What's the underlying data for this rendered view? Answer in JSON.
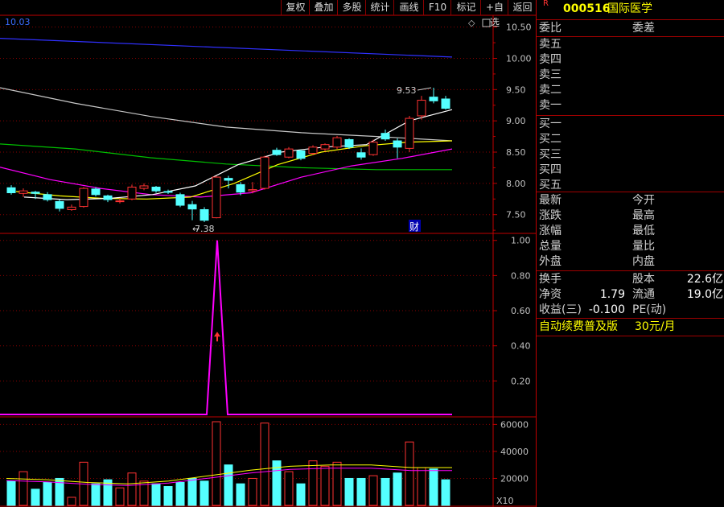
{
  "toolbar": [
    "复权",
    "叠加",
    "多股",
    "统计",
    "画线",
    "F10",
    "标记",
    "+自选",
    "返回"
  ],
  "stock": {
    "flag": "R",
    "code": "000516",
    "name": "国际医学"
  },
  "top_corner_value": "10.03",
  "price_axis": [
    "10.50",
    "10.00",
    "9.50",
    "9.00",
    "8.50",
    "8.00",
    "7.50"
  ],
  "annotations": {
    "high": "9.53",
    "low": "7.38",
    "fin_marker": "财"
  },
  "indicator_axis": [
    "1.00",
    "0.80",
    "0.60",
    "0.40",
    "0.20"
  ],
  "volume_axis": [
    "60000",
    "40000",
    "20000"
  ],
  "volume_unit": "X10",
  "panel": {
    "header": {
      "left": "委比",
      "right": "委差"
    },
    "sell": [
      "卖五",
      "卖四",
      "卖三",
      "卖二",
      "卖一"
    ],
    "buy": [
      "买一",
      "买二",
      "买三",
      "买四",
      "买五"
    ],
    "stats": [
      [
        "最新",
        "",
        "今开",
        ""
      ],
      [
        "涨跌",
        "",
        "最高",
        ""
      ],
      [
        "涨幅",
        "",
        "最低",
        ""
      ],
      [
        "总量",
        "",
        "量比",
        ""
      ],
      [
        "外盘",
        "",
        "内盘",
        ""
      ]
    ],
    "fund": [
      [
        "换手",
        "",
        "股本",
        "22.6亿"
      ],
      [
        "净资",
        "1.79",
        "流通",
        "19.0亿"
      ],
      [
        "收益(三)",
        "-0.100",
        "PE(动)",
        ""
      ]
    ],
    "banner": {
      "label": "自动续费普及版",
      "price": "30元/月"
    }
  },
  "colors": {
    "up": "#ff3232",
    "down": "#54ffff",
    "grid": "#8a0000",
    "border": "#c00000",
    "ma5": "#ffffff",
    "ma10": "#ffff00",
    "ma20": "#ff00ff",
    "ma60": "#00c000",
    "ma120": "#c8c8c8",
    "ma250": "#3030ff",
    "indicator": "#ff00ff"
  },
  "chart_data": {
    "type": "candlestick",
    "price_ylim": [
      7.2,
      10.65
    ],
    "candles": [
      [
        7.93,
        7.85,
        7.97,
        7.82
      ],
      [
        7.84,
        7.88,
        7.92,
        7.78
      ],
      [
        7.86,
        7.84,
        7.88,
        7.75
      ],
      [
        7.82,
        7.74,
        7.86,
        7.71
      ],
      [
        7.71,
        7.6,
        7.74,
        7.55
      ],
      [
        7.58,
        7.62,
        7.66,
        7.56
      ],
      [
        7.63,
        7.92,
        7.94,
        7.61
      ],
      [
        7.91,
        7.82,
        7.94,
        7.79
      ],
      [
        7.8,
        7.74,
        7.82,
        7.7
      ],
      [
        7.72,
        7.72,
        7.76,
        7.68
      ],
      [
        7.75,
        7.94,
        7.98,
        7.73
      ],
      [
        7.92,
        7.96,
        8.0,
        7.89
      ],
      [
        7.94,
        7.88,
        7.96,
        7.85
      ],
      [
        7.87,
        7.86,
        7.9,
        7.83
      ],
      [
        7.82,
        7.65,
        7.85,
        7.62
      ],
      [
        7.66,
        7.59,
        7.72,
        7.41
      ],
      [
        7.58,
        7.41,
        7.62,
        7.38
      ],
      [
        7.45,
        8.1,
        8.12,
        7.44
      ],
      [
        8.08,
        8.05,
        8.12,
        7.92
      ],
      [
        7.98,
        7.86,
        8.02,
        7.81
      ],
      [
        7.88,
        7.9,
        8.02,
        7.84
      ],
      [
        7.92,
        8.42,
        8.44,
        7.9
      ],
      [
        8.53,
        8.46,
        8.57,
        8.44
      ],
      [
        8.42,
        8.55,
        8.58,
        8.4
      ],
      [
        8.52,
        8.4,
        8.54,
        8.37
      ],
      [
        8.48,
        8.58,
        8.61,
        8.45
      ],
      [
        8.55,
        8.62,
        8.64,
        8.51
      ],
      [
        8.58,
        8.73,
        8.76,
        8.55
      ],
      [
        8.7,
        8.58,
        8.72,
        8.55
      ],
      [
        8.49,
        8.42,
        8.56,
        8.38
      ],
      [
        8.46,
        8.66,
        8.7,
        8.44
      ],
      [
        8.8,
        8.71,
        8.86,
        8.68
      ],
      [
        8.68,
        8.58,
        8.72,
        8.4
      ],
      [
        8.56,
        9.04,
        9.08,
        8.5
      ],
      [
        9.08,
        9.33,
        9.4,
        9.02
      ],
      [
        9.38,
        9.32,
        9.53,
        9.28
      ],
      [
        9.35,
        9.2,
        9.4,
        9.18
      ]
    ],
    "ma_lines": {
      "ma250": [
        10.32,
        10.02
      ],
      "ma120": [
        9.53,
        9.28,
        9.07,
        8.9,
        8.81,
        8.75,
        8.68
      ],
      "ma60": [
        8.63,
        8.55,
        8.41,
        8.31,
        8.25,
        8.22,
        8.22
      ],
      "ma20": [
        8.26,
        8.06,
        7.92,
        7.82,
        7.78,
        7.85,
        8.1,
        8.28,
        8.4,
        8.55
      ],
      "ma10": [
        7.87,
        7.8,
        7.76,
        7.75,
        7.78,
        8.0,
        8.3,
        8.5,
        8.6,
        8.66,
        8.68
      ],
      "ma5": [
        7.78,
        7.74,
        7.76,
        7.82,
        7.96,
        8.3,
        8.5,
        8.58,
        8.62,
        9.0,
        9.18
      ]
    },
    "indicator_ylim": [
      0,
      1.04
    ],
    "indicator_spike": {
      "candle": 17,
      "value": 1.0
    },
    "volume_ylim": [
      0,
      65000
    ],
    "volume": [
      18000,
      25000,
      12000,
      17000,
      20000,
      6000,
      32000,
      16000,
      19000,
      13000,
      24000,
      18000,
      16000,
      14000,
      17000,
      20000,
      18000,
      62000,
      30000,
      16000,
      20000,
      61000,
      33000,
      25000,
      16000,
      33000,
      29000,
      32000,
      20000,
      20000,
      22000,
      20000,
      24000,
      47000,
      28000,
      27000,
      19000
    ],
    "vol_ma": [
      20000,
      19000,
      17000,
      16000,
      18000,
      22000,
      26000,
      29000,
      30000,
      30000,
      28000,
      28000
    ]
  }
}
